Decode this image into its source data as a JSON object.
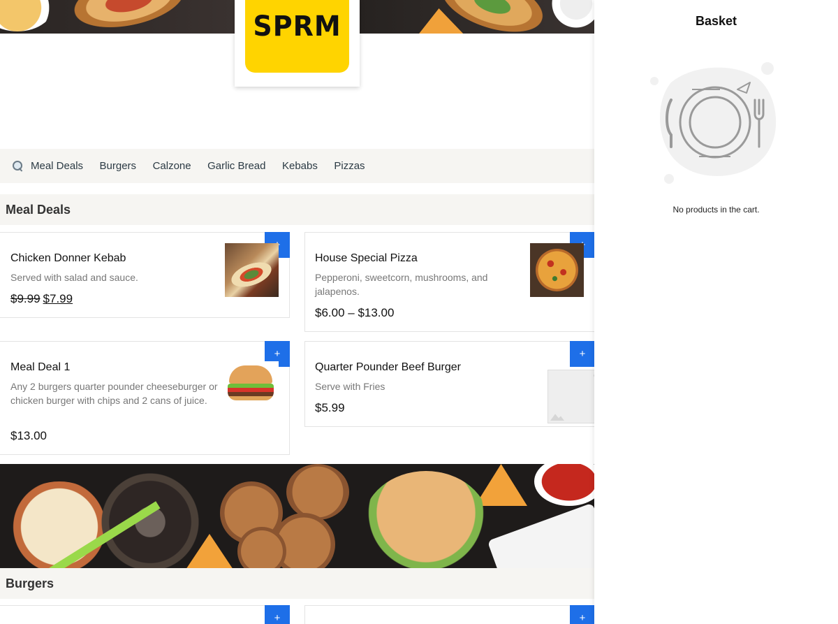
{
  "brand": {
    "logo_text": "SPRM",
    "accent": "#ffd400",
    "button_color": "#1e6fe8"
  },
  "category_nav": {
    "search_icon": "search-icon",
    "items": [
      "Meal Deals",
      "Burgers",
      "Calzone",
      "Garlic Bread",
      "Kebabs",
      "Pizzas"
    ]
  },
  "sections": [
    {
      "title": "Meal Deals",
      "products": [
        {
          "name": "Chicken Donner Kebab",
          "desc": "Served with salad and sauce.",
          "old_price": "$9.99",
          "price": "$7.99",
          "add_label": "+"
        },
        {
          "name": "House Special Pizza",
          "desc": "Pepperoni, sweetcorn, mushrooms, and jalapenos.",
          "price": "$6.00 – $13.00",
          "add_label": "+"
        },
        {
          "name": "Meal Deal 1",
          "desc": "Any 2 burgers quarter pounder cheeseburger or chicken burger with chips and 2 cans of juice.",
          "price": "$13.00",
          "add_label": "+"
        },
        {
          "name": "Quarter Pounder Beef Burger",
          "desc": "Serve with Fries",
          "price": "$5.99",
          "add_label": "+"
        }
      ]
    },
    {
      "title": "Burgers",
      "products": [
        {
          "add_label": "+"
        },
        {
          "add_label": "+"
        }
      ]
    }
  ],
  "basket": {
    "title": "Basket",
    "empty_message": "No products in the cart."
  }
}
